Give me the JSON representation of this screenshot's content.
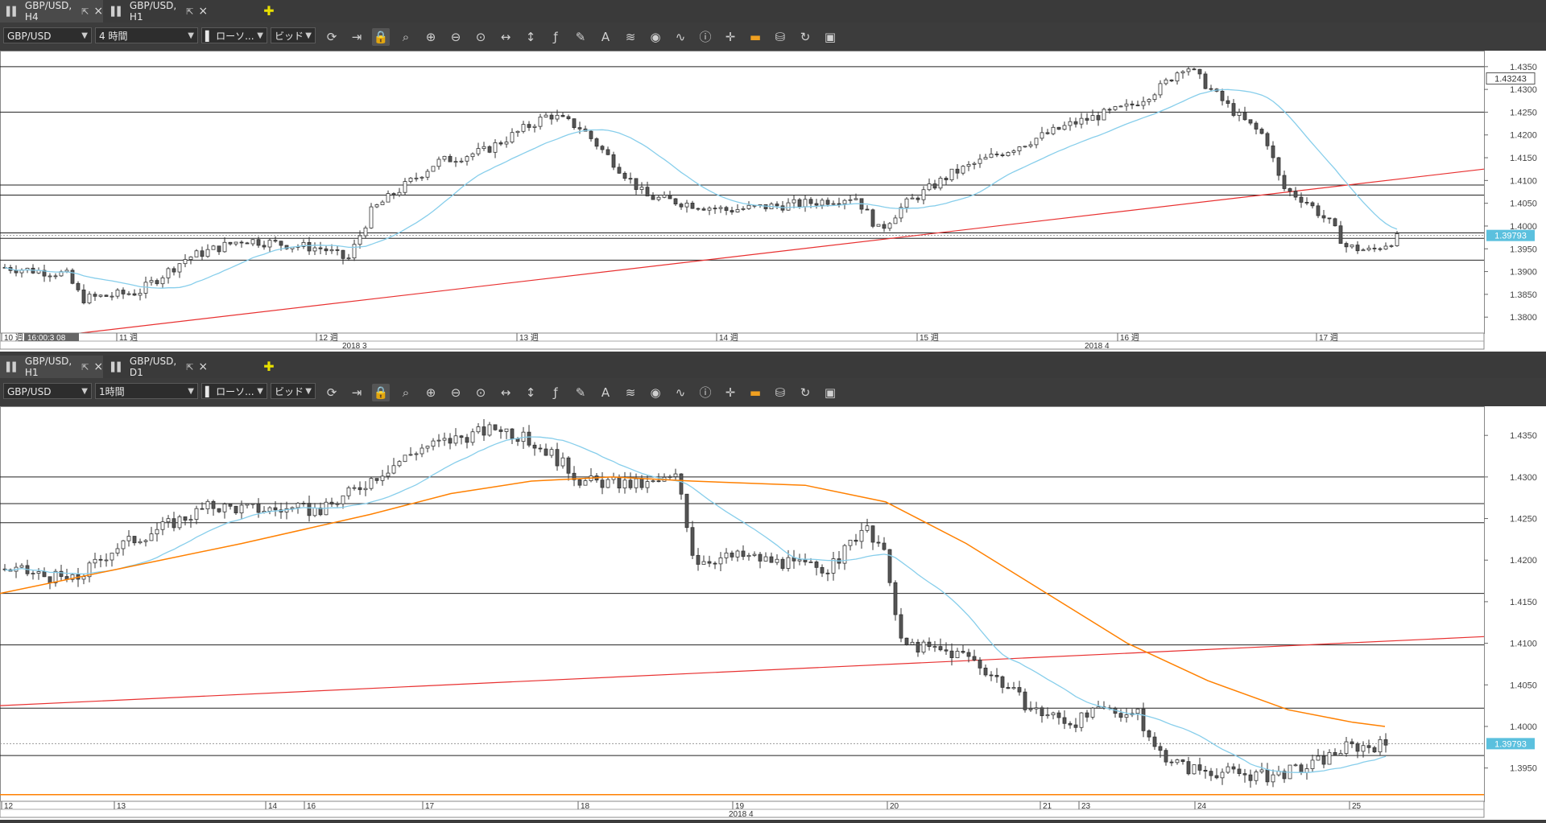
{
  "panel_top": {
    "tabs": [
      {
        "label": "GBP/USD, H4",
        "active": true
      },
      {
        "label": "GBP/USD, H1",
        "active": false
      }
    ],
    "toolbar": {
      "symbol": "GBP/USD",
      "timeframe": "4 時間",
      "chart_type": "ローソ...",
      "price_type": "ビッド"
    },
    "price_labels": [
      "1.4350",
      "1.4300",
      "1.4250",
      "1.4200",
      "1.4150",
      "1.4100",
      "1.4050",
      "1.4000",
      "1.3950",
      "1.3900",
      "1.3850",
      "1.3800"
    ],
    "current_price": "1.39793",
    "line_price": "1.43243",
    "time_labels": [
      "10 週",
      "11 週",
      "12 週",
      "13 週",
      "14 週",
      "15 週",
      "16 週",
      "17 週"
    ],
    "cursor_time": "16:00:3 08",
    "month_labels": [
      "2018 3",
      "2018 4"
    ]
  },
  "panel_bottom": {
    "tabs": [
      {
        "label": "GBP/USD, H1",
        "active": true
      },
      {
        "label": "GBP/USD, D1",
        "active": false
      }
    ],
    "toolbar": {
      "symbol": "GBP/USD",
      "timeframe": "1時間",
      "chart_type": "ローソ...",
      "price_type": "ビッド"
    },
    "price_labels": [
      "1.4350",
      "1.4300",
      "1.4250",
      "1.4200",
      "1.4150",
      "1.4100",
      "1.4050",
      "1.4000",
      "1.3950"
    ],
    "current_price": "1.39793",
    "time_labels": [
      "12",
      "13",
      "14",
      "16",
      "17",
      "18",
      "19",
      "20",
      "21",
      "23",
      "24",
      "25"
    ],
    "month_labels": [
      "2018 4"
    ]
  },
  "colors": {
    "accent": "#5bc0de",
    "ma_fast": "#87ceeb",
    "ma_slow": "#ff8000",
    "trend": "#e83030",
    "candle": "#555555"
  },
  "chart_data": [
    {
      "type": "candlestick",
      "symbol": "GBP/USD",
      "timeframe": "H4",
      "ylim": [
        1.3765,
        1.4385
      ],
      "x": [
        "10 週",
        "11 週",
        "12 週",
        "13 週",
        "14 週",
        "15 週",
        "16 週",
        "17 週"
      ],
      "close_approx": [
        1.39,
        1.392,
        1.396,
        1.415,
        1.405,
        1.412,
        1.434,
        1.3979
      ],
      "horizontal_levels": [
        1.435,
        1.425,
        1.409,
        1.4068,
        1.3985,
        1.3973,
        1.3925
      ],
      "trendline": {
        "start": 1.379,
        "end": 1.4125
      },
      "last_price": 1.39793
    },
    {
      "type": "candlestick",
      "symbol": "GBP/USD",
      "timeframe": "H1",
      "ylim": [
        1.391,
        1.4385
      ],
      "x": [
        "12",
        "13",
        "14",
        "16",
        "17",
        "18",
        "19",
        "20",
        "21",
        "23",
        "24",
        "25"
      ],
      "close_approx": [
        1.419,
        1.423,
        1.427,
        1.426,
        1.432,
        1.43,
        1.42,
        1.41,
        1.404,
        1.4,
        1.394,
        1.3979
      ],
      "horizontal_levels": [
        1.43,
        1.4268,
        1.4245,
        1.416,
        1.4098,
        1.4022,
        1.3965,
        1.3918
      ],
      "trendline": {
        "start": 1.4025,
        "end": 1.4108
      },
      "last_price": 1.39793
    }
  ]
}
